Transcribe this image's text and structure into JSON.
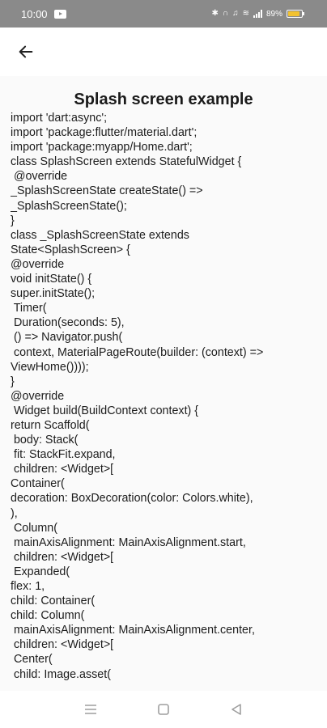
{
  "status_bar": {
    "time": "10:00",
    "battery_text": "89%",
    "colors": {
      "background": "#8a8a8a",
      "battery_fill": "#f2c230"
    },
    "icons": [
      "youtube-icon",
      "bluetooth-icon",
      "headset-icon",
      "bell-icon",
      "wifi-icon",
      "signal-icon",
      "battery-icon"
    ]
  },
  "app_bar": {
    "back_icon": "arrow-left-icon"
  },
  "page": {
    "title": "Splash screen example",
    "code_lines": [
      "import 'dart:async';",
      "import 'package:flutter/material.dart';",
      "import 'package:myapp/Home.dart';",
      "class SplashScreen extends StatefulWidget {",
      " @override",
      "_SplashScreenState createState() =>",
      "_SplashScreenState();",
      "}",
      "class _SplashScreenState extends",
      "State<SplashScreen> {",
      "@override",
      "void initState() {",
      "super.initState();",
      " Timer(",
      " Duration(seconds: 5),",
      " () => Navigator.push(",
      " context, MaterialPageRoute(builder: (context) =>",
      "ViewHome())));",
      "}",
      "@override",
      " Widget build(BuildContext context) {",
      "return Scaffold(",
      " body: Stack(",
      " fit: StackFit.expand,",
      " children: <Widget>[",
      "Container(",
      "decoration: BoxDecoration(color: Colors.white),",
      "),",
      " Column(",
      " mainAxisAlignment: MainAxisAlignment.start,",
      " children: <Widget>[",
      " Expanded(",
      "flex: 1,",
      "child: Container(",
      "child: Column(",
      " mainAxisAlignment: MainAxisAlignment.center,",
      " children: <Widget>[",
      " Center(",
      " child: Image.asset("
    ]
  },
  "nav_bar": {
    "icons": [
      "menu-icon",
      "home-square-icon",
      "back-triangle-icon"
    ]
  }
}
